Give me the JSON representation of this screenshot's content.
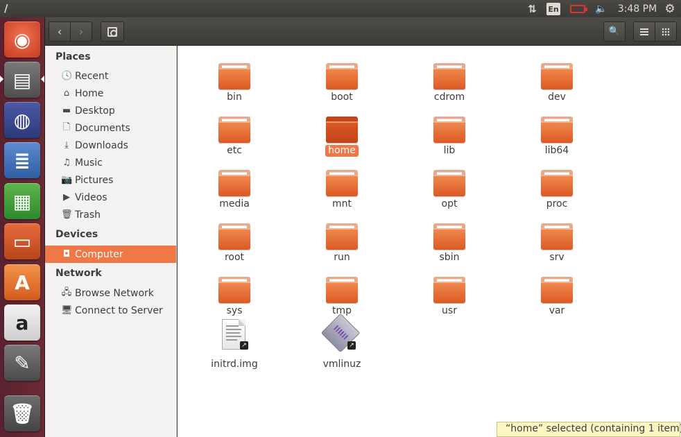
{
  "top_panel": {
    "title": "/",
    "network_icon": "⇅",
    "keyboard_layout": "En",
    "volume_icon": "🔈",
    "time": "3:48 PM",
    "session_icon": "⚙"
  },
  "launcher": {
    "items": [
      {
        "name": "ubuntu-dash",
        "glyph": "◉"
      },
      {
        "name": "files",
        "glyph": "▤"
      },
      {
        "name": "firefox",
        "glyph": "◍"
      },
      {
        "name": "libreoffice-writer",
        "glyph": "≣"
      },
      {
        "name": "libreoffice-calc",
        "glyph": "▦"
      },
      {
        "name": "libreoffice-impress",
        "glyph": "▭"
      },
      {
        "name": "software-center",
        "glyph": "A"
      },
      {
        "name": "amazon",
        "glyph": "a"
      },
      {
        "name": "system-settings",
        "glyph": "✎"
      },
      {
        "name": "trash",
        "glyph": "🗑"
      }
    ]
  },
  "header": {
    "back_icon": "‹",
    "forward_icon": "›",
    "search_icon": "🔍"
  },
  "sidebar": {
    "places_header": "Places",
    "places": [
      {
        "label": "Recent",
        "icon": "🕓"
      },
      {
        "label": "Home",
        "icon": "⌂"
      },
      {
        "label": "Desktop",
        "icon": "▬"
      },
      {
        "label": "Documents",
        "icon": "🗋"
      },
      {
        "label": "Downloads",
        "icon": "⤓"
      },
      {
        "label": "Music",
        "icon": "♫"
      },
      {
        "label": "Pictures",
        "icon": "📷"
      },
      {
        "label": "Videos",
        "icon": "▶"
      },
      {
        "label": "Trash",
        "icon": "🗑"
      }
    ],
    "devices_header": "Devices",
    "devices": [
      {
        "label": "Computer",
        "icon": "◘",
        "selected": true
      }
    ],
    "network_header": "Network",
    "network": [
      {
        "label": "Browse Network",
        "icon": "🖧"
      },
      {
        "label": "Connect to Server",
        "icon": "🖥"
      }
    ]
  },
  "main": {
    "items": [
      {
        "label": "bin",
        "type": "folder"
      },
      {
        "label": "boot",
        "type": "folder"
      },
      {
        "label": "cdrom",
        "type": "folder"
      },
      {
        "label": "dev",
        "type": "folder"
      },
      {
        "label": "etc",
        "type": "folder"
      },
      {
        "label": "home",
        "type": "folder",
        "selected": true
      },
      {
        "label": "lib",
        "type": "folder"
      },
      {
        "label": "lib64",
        "type": "folder"
      },
      {
        "label": "media",
        "type": "folder"
      },
      {
        "label": "mnt",
        "type": "folder"
      },
      {
        "label": "opt",
        "type": "folder"
      },
      {
        "label": "proc",
        "type": "folder"
      },
      {
        "label": "root",
        "type": "folder"
      },
      {
        "label": "run",
        "type": "folder"
      },
      {
        "label": "sbin",
        "type": "folder"
      },
      {
        "label": "srv",
        "type": "folder"
      },
      {
        "label": "sys",
        "type": "folder"
      },
      {
        "label": "tmp",
        "type": "folder"
      },
      {
        "label": "usr",
        "type": "folder"
      },
      {
        "label": "var",
        "type": "folder"
      },
      {
        "label": "initrd.img",
        "type": "document-link"
      },
      {
        "label": "vmlinuz",
        "type": "binary-link"
      }
    ]
  },
  "status": {
    "text": "“home” selected  (containing 1 item)"
  },
  "colors": {
    "accent": "#f07746",
    "launcher": "#5a2230",
    "panel": "#3c3b37",
    "status_bg": "#fdf7c3"
  }
}
